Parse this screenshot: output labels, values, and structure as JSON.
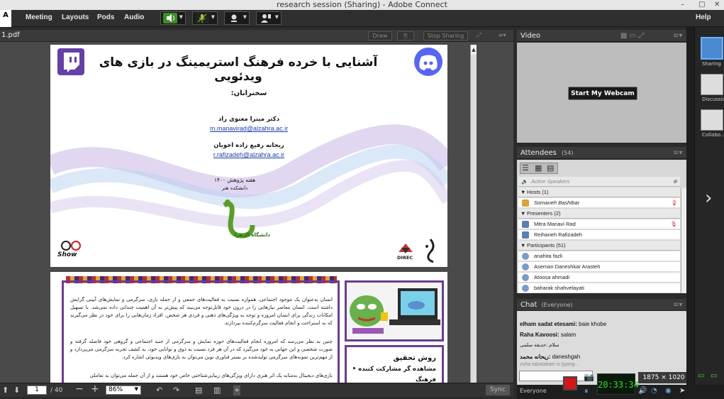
{
  "window": {
    "title": "research session (Sharing) - Adobe Connect"
  },
  "menubar": {
    "logo": "A",
    "items": [
      "Meeting",
      "Layouts",
      "Pods",
      "Audio"
    ],
    "help": "Help"
  },
  "share": {
    "file_name": "1.pdf",
    "draw_label": "Draw",
    "stop_sharing_label": "Stop Sharing"
  },
  "slide1": {
    "title": "آشنایی با خرده فرهنگ استریمینگ در بازی های ویدئویی",
    "speakers_label": "سخنرانان:",
    "speaker1_name": "دکتر میترا معنوی راد",
    "speaker1_email": "m.manavirad@alzahra.ac.ir",
    "speaker2_name": "ریحانه رفیع زاده اخویان",
    "speaker2_email": "r.rafizadeh@alzahra.ac.ir",
    "event": "هفته پژوهش ۱۴۰۰",
    "faculty": "دانشکده هنر",
    "university_logo_text": "دانشگاه الزهرا",
    "bottom_left_logo_text": "Show",
    "bottom_right_logo_text": "DIREC"
  },
  "slide2": {
    "para1": "انسان به‌عنوان یک موجود اجتماعی، همواره نسبت به فعالیت‌های جمعی و از جمله بازی، سرگرمی و نمایش‌های آیینی گرایش داشته است. انسان معاصر نیازهایی را در درون خود قابل‌توجه می‌بیند که پیش‌تر به آن اهمیت چندانی داده نمی‌شد. با تسهیل امکانات زندگی برای انسان امروزه و توجه به ویژگی‌های ذهنی و فردی هر شخص، افراد زمان‌هایی را برای خود در نظر می‌گیرند که به استراحت و انجام فعالیت سرگرم‌کننده بپردازند.",
    "para2": "چنین به نظر می‌رسد که امروزه انجام فعالیت‌های حوزه نمایش و سرگرمی از جنبه اجتماعی و گروهی خود فاصله گرفته و صورت شخصی و این جهانی به خود می‌گیرد که در آن هر فرد نسبت به ذوق و توانایی خود، به کشف تجربه سرگرمی می‌پردازد و از مهم‌ترین نمونه‌های سرگرمی تولیدشده بر بستر فناوری نوین می‌توان به بازی‌های ویدیوئی اشاره کرد.",
    "para3": "بازی‌های دیجیتال به‌مثابه یک اثر هنری دارای ویژگی‌های زیبایی‌شناختی خاص خود هستند و از آن جمله می‌توان به تعاملی",
    "method_title": "روش تحقیق",
    "method_item1": "مشاهده گر مشارکت کننده",
    "method_item2": "فرهنگ"
  },
  "nav": {
    "page": "1",
    "total": "/ 40",
    "zoom": "86%",
    "sync": "Sync"
  },
  "video": {
    "title": "Video",
    "webcam_button": "Start My Webcam"
  },
  "attendees": {
    "title": "Attendees",
    "count": "(54)",
    "active_speakers": "Active Speakers",
    "hosts_label": "Hosts (1)",
    "hosts": [
      "Somaneh Bashtbar"
    ],
    "presenters_label": "Presenters (2)",
    "presenters": [
      "Mitra Manavi Rad",
      "Reihaneh Rafizadeh"
    ],
    "participants_label": "Participants (51)",
    "participants": [
      "anahita fazli",
      "Aseman Daneshkar Arasteh",
      "Atoosa ahmadi",
      "baharak shahvelayati"
    ]
  },
  "chat": {
    "title": "Chat",
    "scope": "(Everyone)",
    "messages": [
      {
        "sender": "elham sadat etesami:",
        "text": "baie khobe"
      },
      {
        "sender": "Raha Kavoosi:",
        "text": "salam"
      },
      {
        "sender": "",
        "text": "سلام :حدیقه سلمی"
      },
      {
        "sender": "ریحانه محمد:",
        "text": "daneshgah"
      }
    ],
    "typing": "zoha tabatabaei is typing...",
    "recipient": "Everyone"
  },
  "layouts": {
    "items": [
      "Sharing",
      "Discussio",
      "Collabo..."
    ]
  },
  "taskbar": {
    "clock": "20:33:34",
    "resolution": "1875 × 1020"
  },
  "colors": {
    "accent_blue": "#1b3fae",
    "record_red": "#d01818",
    "slide2_border": "#6b3d8f",
    "twitch": "#6441a5",
    "discord": "#5865f2"
  }
}
